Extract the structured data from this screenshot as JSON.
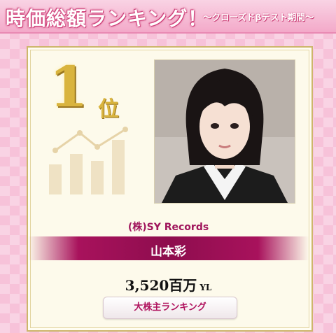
{
  "header": {
    "title": "時価総額ランキング！",
    "subtitle": "〜クローズドβテスト期間〜"
  },
  "card": {
    "rank_number": "1",
    "rank_suffix": "位",
    "company": "(株)SY Records",
    "name": "山本彩",
    "value": "3,520百万",
    "unit": "YL",
    "button_label": "大株主ランキング"
  },
  "colors": {
    "accent": "#a8125c",
    "gold": "#d9b43e",
    "card_background": "#fdfaeb",
    "header_pink": "#f3a9c9"
  },
  "icons": {
    "chart": "rising-bar-chart-icon"
  }
}
